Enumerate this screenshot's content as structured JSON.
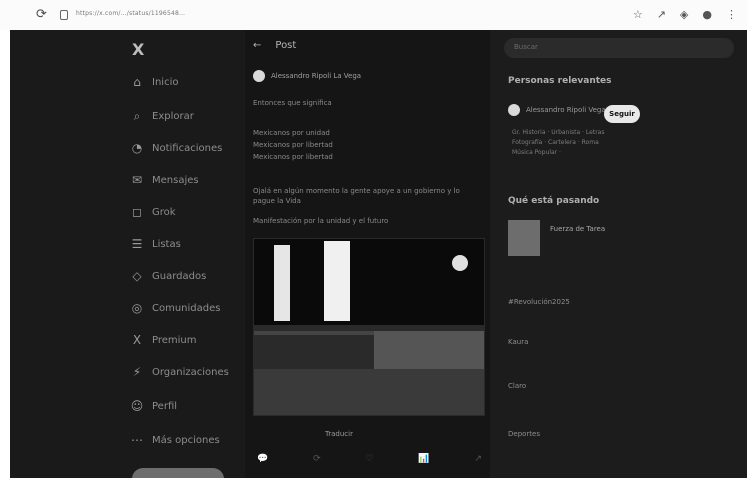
{
  "browser": {
    "url": "https://x.com/…/status/1196548…",
    "icons": [
      "reload-icon",
      "lock-icon",
      "bookmark-icon",
      "extension-icon",
      "profile-icon",
      "menu-icon"
    ]
  },
  "sidebar": {
    "logo_text": "X",
    "items": [
      {
        "label": "Inicio",
        "icon": "⌂"
      },
      {
        "label": "Explorar",
        "icon": "⌕"
      },
      {
        "label": "Notificaciones",
        "icon": "◔"
      },
      {
        "label": "Mensajes",
        "icon": "✉"
      },
      {
        "label": "Grok",
        "icon": "◻"
      },
      {
        "label": "Listas",
        "icon": "☰"
      },
      {
        "label": "Guardados",
        "icon": "◇"
      },
      {
        "label": "Comunidades",
        "icon": "◎"
      },
      {
        "label": "Premium",
        "icon": "X"
      },
      {
        "label": "Organizaciones",
        "icon": "⚡"
      },
      {
        "label": "Perfil",
        "icon": "☺"
      },
      {
        "label": "Más opciones",
        "icon": "⋯"
      }
    ]
  },
  "main": {
    "header": {
      "back": "←",
      "title": "Post"
    },
    "author": {
      "name": "Alessandro Ripoli La Vega"
    },
    "lines": [
      "Entonces que significa",
      "",
      "Mexicanos por unidad",
      "Mexicanos por libertad",
      "Mexicanos por libertad",
      "",
      "Ojalá en algún momento la gente apoye a un gobierno y lo pague la Vida",
      "",
      "Manifestación por la unidad y el futuro"
    ],
    "caption": "Traducir",
    "actions": [
      "💬",
      "⟳",
      "♡",
      "📊",
      "↗"
    ]
  },
  "right": {
    "search_placeholder": "Buscar",
    "relevant_title": "Personas relevantes",
    "relevant_person": "Alessandro Ripoli Vega",
    "follow_label": "Seguir",
    "relevant_bio": [
      "Gr. Historia · Urbanista · Letras",
      "Fotografía · Cartelera · Roma",
      "Música Popular ·"
    ],
    "happening_title": "Qué está pasando",
    "trend_main": "Fuerza de Tarea",
    "trends": [
      "#Revolución2025",
      "Kaura",
      "Claro",
      "Deportes"
    ]
  }
}
